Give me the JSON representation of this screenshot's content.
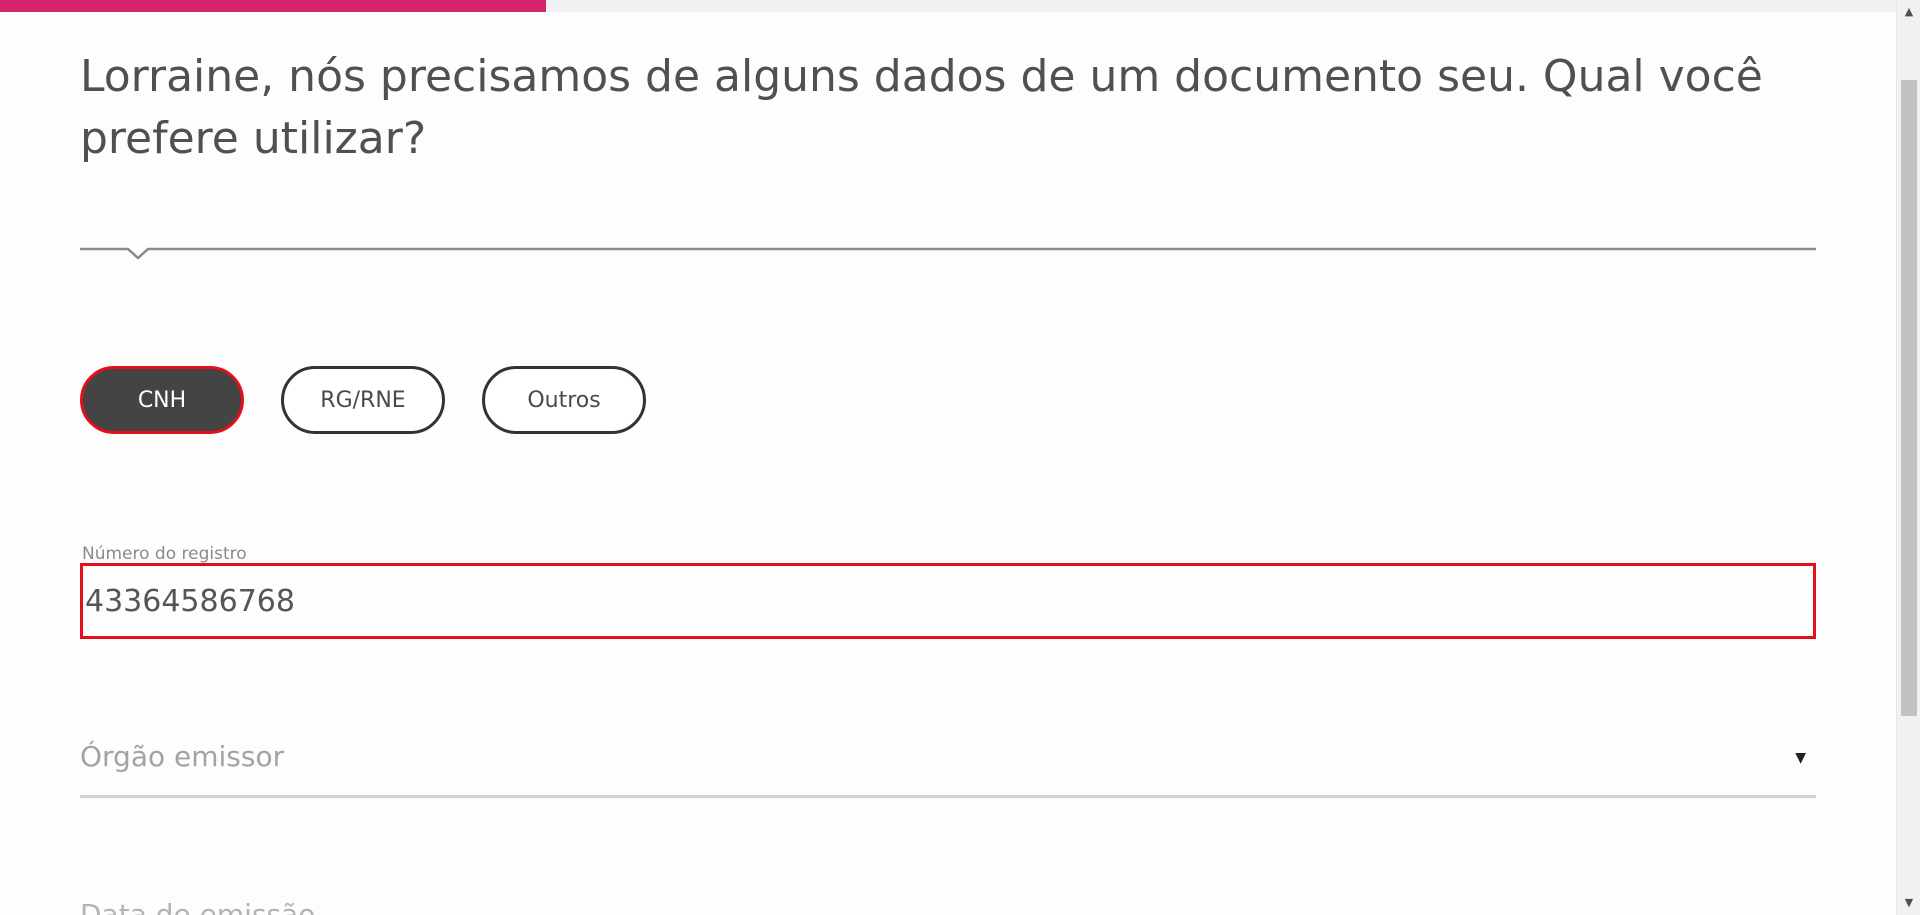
{
  "progress": {
    "fraction": 0.288,
    "color": "#d3246d"
  },
  "question": {
    "text": "Lorraine, nós precisamos de alguns dados de um documento seu. Qual você prefere utilizar?"
  },
  "doc_types": {
    "options": [
      {
        "label": "CNH",
        "selected": true
      },
      {
        "label": "RG/RNE",
        "selected": false
      },
      {
        "label": "Outros",
        "selected": false
      }
    ]
  },
  "registration": {
    "label": "Número do registro",
    "value": "43364586768"
  },
  "issuer": {
    "placeholder": "Órgão emissor",
    "icon": "caret-down-icon"
  },
  "next_field": {
    "label": "Data de emissão"
  },
  "colors": {
    "accent": "#d3246d",
    "error_border": "#e3101b",
    "active_pill_bg": "#444444"
  }
}
